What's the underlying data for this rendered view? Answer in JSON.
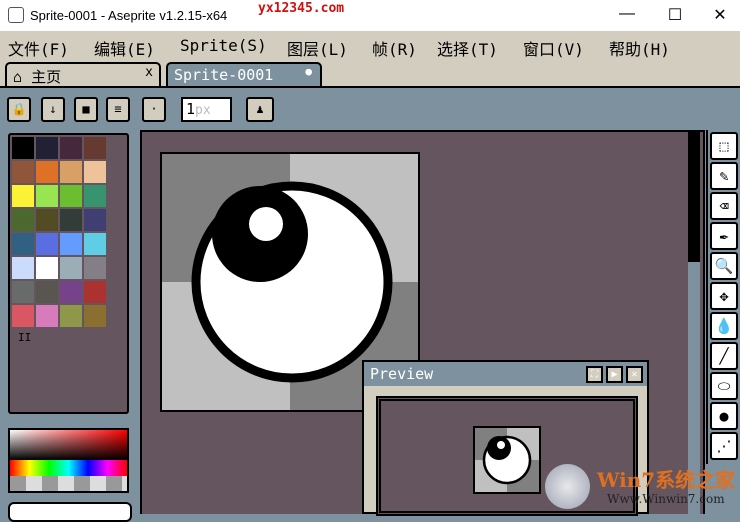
{
  "title": {
    "text": "Sprite-0001 - Aseprite v1.2.15-x64",
    "watermark": "yx12345.com",
    "minimize": "—",
    "maximize": "☐",
    "close": "✕"
  },
  "menu": [
    "文件(F)",
    "编辑(E)",
    "Sprite(S)",
    "图层(L)",
    "帧(R)",
    "选择(T)",
    "窗口(V)",
    "帮助(H)"
  ],
  "tabs": {
    "home": "主页",
    "home_close": "x",
    "sprite": "Sprite-0001",
    "sprite_modified": "●"
  },
  "toolbar": {
    "lock": "🔒",
    "down": "↓",
    "page": "■",
    "menu": "≡",
    "dot": "·",
    "brush_size": "1",
    "brush_unit": "px",
    "stamp": "♟"
  },
  "palette": {
    "colors": [
      "#000000",
      "#222034",
      "#45283c",
      "#663931",
      "#8f563b",
      "#df7126",
      "#d9a066",
      "#eec39a",
      "#fbf236",
      "#99e550",
      "#6abe30",
      "#37946e",
      "#4b692f",
      "#524b24",
      "#323c39",
      "#3f3f74",
      "#306082",
      "#5b6ee1",
      "#639bff",
      "#5fcde4",
      "#cbdbfc",
      "#ffffff",
      "#9badb7",
      "#847e87",
      "#696a6a",
      "#595652",
      "#76428a",
      "#ac3232",
      "#d95763",
      "#d77bba",
      "#8f974a",
      "#8a6f30"
    ],
    "pause": "II"
  },
  "preview": {
    "title": "Preview",
    "btn_expand": "⛶",
    "btn_play": "▶",
    "btn_close": "✕"
  },
  "tools": [
    "⬚",
    "✎",
    "⌫",
    "✒",
    "🔍",
    "✥",
    "💧",
    "╱",
    "⬭",
    "●",
    "⋰"
  ],
  "tool_names": [
    "rectangle-marquee",
    "pencil",
    "eraser",
    "eyedropper",
    "zoom",
    "move",
    "paint-bucket",
    "line",
    "ellipse",
    "contour",
    "spray"
  ],
  "watermark2": {
    "brand": "Win7系统之家",
    "url": "Www.Winwin7.com"
  }
}
